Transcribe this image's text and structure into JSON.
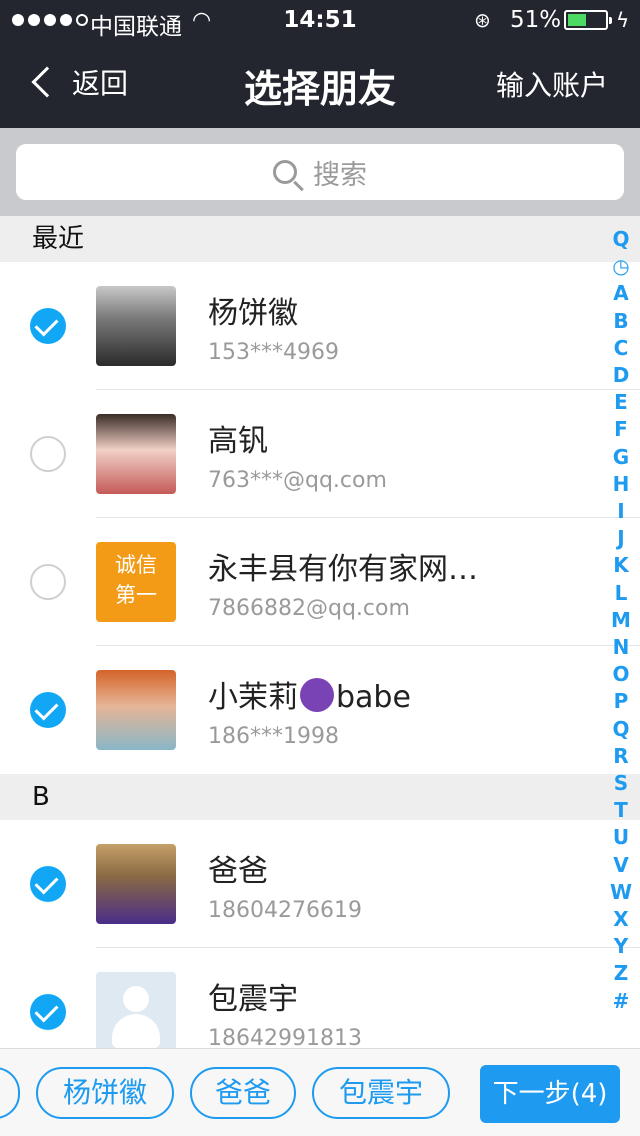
{
  "status_bar": {
    "carrier": "中国联通",
    "time": "14:51",
    "battery_percent": "51%",
    "battery_level": 0.51,
    "signal_filled": 4,
    "icons": [
      "wifi-icon",
      "rotation-lock-icon",
      "battery-icon",
      "charging-icon"
    ]
  },
  "nav": {
    "back_label": "返回",
    "title": "选择朋友",
    "right_label": "输入账户"
  },
  "search": {
    "placeholder": "搜索"
  },
  "sections": [
    {
      "header": "最近",
      "contacts": [
        {
          "name": "杨饼徽",
          "detail": "153***4969",
          "checked": true
        },
        {
          "name": "高钒",
          "detail": "763***@qq.com",
          "checked": false
        },
        {
          "name": "永丰县有你有家网…",
          "detail": "7866882@qq.com",
          "checked": false,
          "avatar_text": [
            "诚信",
            "第一"
          ]
        },
        {
          "name_prefix": "小茉莉",
          "name_suffix": "babe",
          "detail": "186***1998",
          "checked": true
        }
      ]
    },
    {
      "header": "B",
      "contacts": [
        {
          "name": "爸爸",
          "detail": "18604276619",
          "checked": true
        },
        {
          "name": "包震宇",
          "detail": "18642991813",
          "checked": true
        }
      ]
    }
  ],
  "index": [
    "Q",
    "◷",
    "A",
    "B",
    "C",
    "D",
    "E",
    "F",
    "G",
    "H",
    "I",
    "J",
    "K",
    "L",
    "M",
    "N",
    "O",
    "P",
    "Q",
    "R",
    "S",
    "T",
    "U",
    "V",
    "W",
    "X",
    "Y",
    "Z",
    "#"
  ],
  "selected": [
    "杨饼徽",
    "爸爸",
    "包震宇"
  ],
  "next_label": "下一步(4)",
  "colors": {
    "accent": "#1e9bf0",
    "nav_bg": "#23262f"
  }
}
